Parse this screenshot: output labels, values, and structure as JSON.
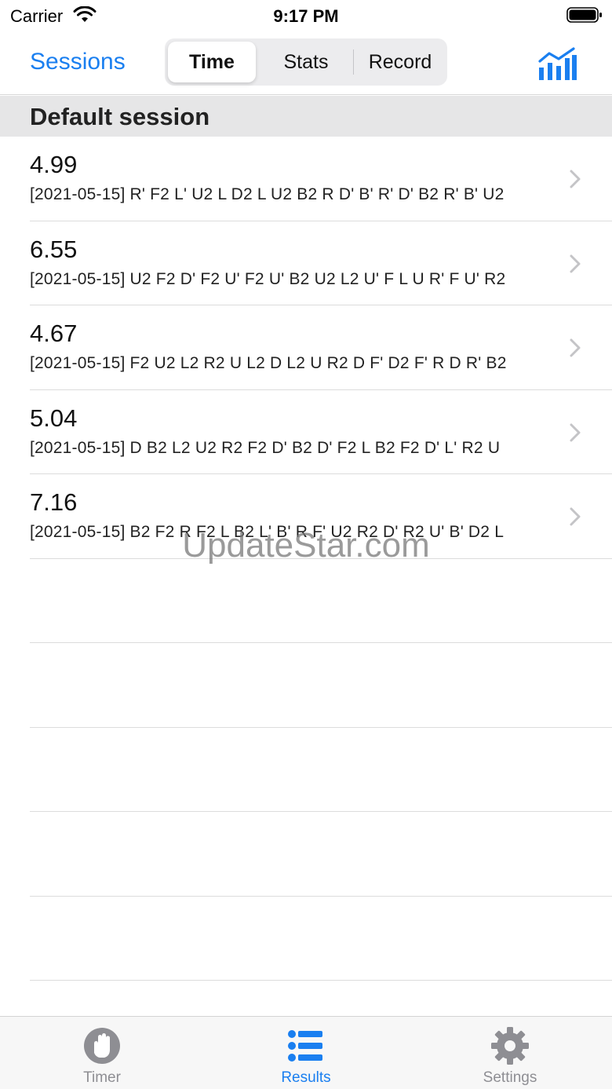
{
  "status_bar": {
    "carrier": "Carrier",
    "time": "9:17 PM"
  },
  "nav": {
    "sessions_label": "Sessions",
    "segments": [
      {
        "label": "Time",
        "selected": true
      },
      {
        "label": "Stats",
        "selected": false
      },
      {
        "label": "Record",
        "selected": false
      }
    ],
    "chart_icon": "chart-bars-icon"
  },
  "section": {
    "title": "Default session"
  },
  "results": [
    {
      "time": "4.99",
      "scramble": "[2021-05-15] R' F2 L' U2 L D2 L U2 B2 R D' B' R' D' B2 R' B' U2"
    },
    {
      "time": "6.55",
      "scramble": "[2021-05-15] U2 F2 D' F2 U' F2 U' B2 U2 L2 U' F L U R' F U' R2"
    },
    {
      "time": "4.67",
      "scramble": "[2021-05-15] F2 U2 L2 R2 U L2 D L2 U R2 D F' D2 F' R D R' B2"
    },
    {
      "time": "5.04",
      "scramble": "[2021-05-15] D B2 L2 U2 R2 F2 D' B2 D' F2 L B2 F2 D' L' R2 U"
    },
    {
      "time": "7.16",
      "scramble": "[2021-05-15] B2 F2 R F2 L B2 L' B' R F' U2 R2 D' R2 U' B' D2 L"
    }
  ],
  "watermark": "UpdateStar.com",
  "tab_bar": {
    "tabs": [
      {
        "label": "Timer",
        "icon": "timer-hand-icon",
        "active": false
      },
      {
        "label": "Results",
        "icon": "list-icon",
        "active": true
      },
      {
        "label": "Settings",
        "icon": "gear-icon",
        "active": false
      }
    ]
  },
  "colors": {
    "accent": "#1a7ff0",
    "section_bg": "#e6e6e7",
    "tab_inactive": "#8e8e93"
  }
}
